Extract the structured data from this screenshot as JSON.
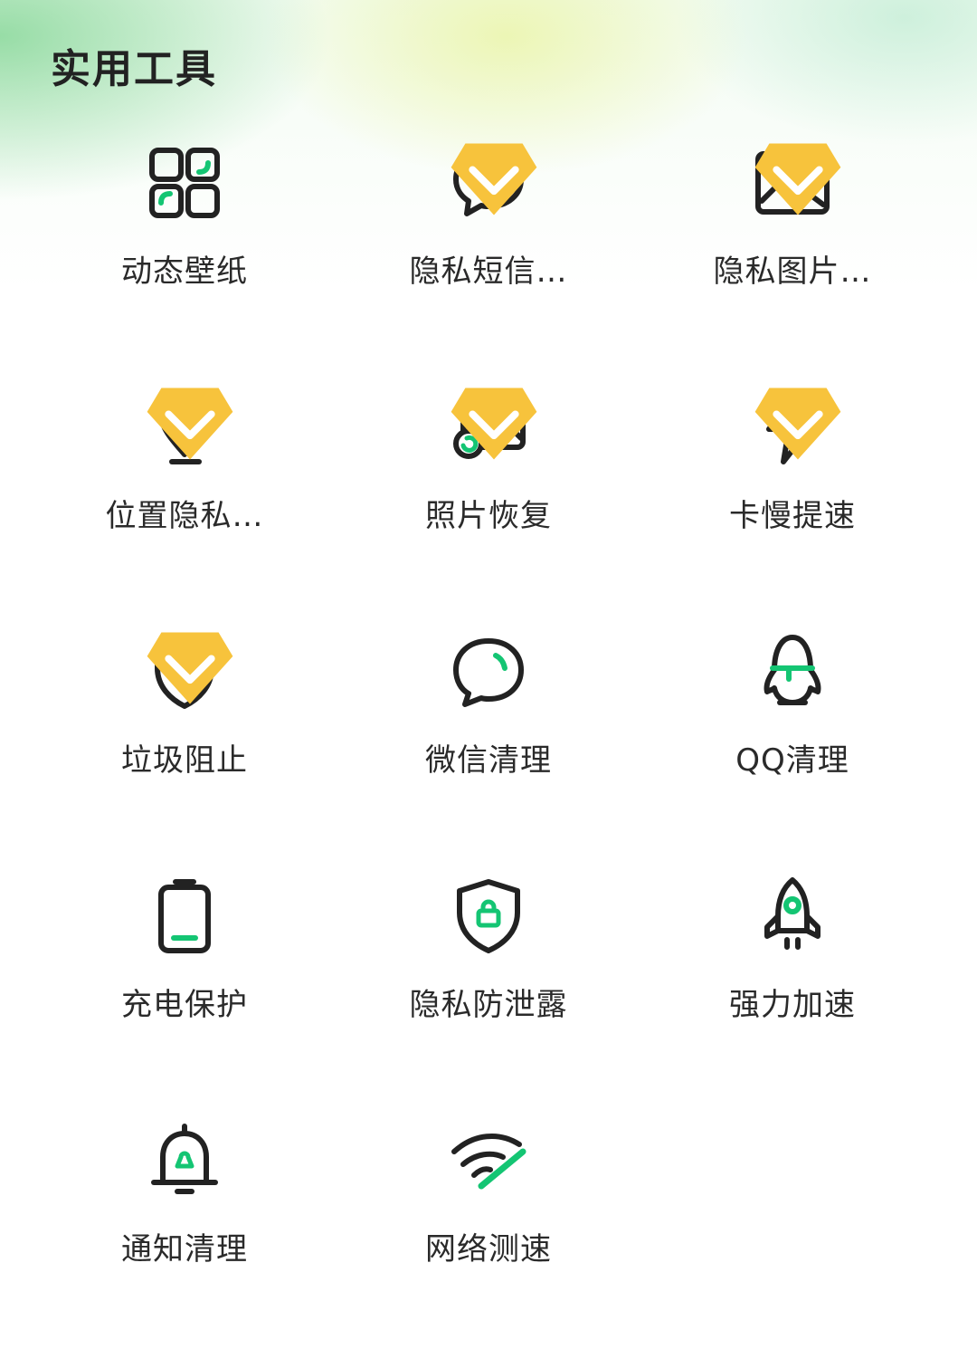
{
  "header": {
    "title": "实用工具"
  },
  "colors": {
    "accent": "#14c573",
    "stroke": "#222222",
    "vip_gold": "#f7c33c"
  },
  "tools": [
    {
      "label": "动态壁纸",
      "icon": "wallpaper-grid-icon",
      "vip": false
    },
    {
      "label": "隐私短信…",
      "icon": "chat-bubble-icon",
      "vip": true
    },
    {
      "label": "隐私图片…",
      "icon": "image-icon",
      "vip": true
    },
    {
      "label": "位置隐私…",
      "icon": "location-pin-icon",
      "vip": true
    },
    {
      "label": "照片恢复",
      "icon": "photo-restore-icon",
      "vip": true
    },
    {
      "label": "卡慢提速",
      "icon": "lightning-icon",
      "vip": true
    },
    {
      "label": "垃圾阻止",
      "icon": "shield-plus-icon",
      "vip": true
    },
    {
      "label": "微信清理",
      "icon": "wechat-bubble-icon",
      "vip": false
    },
    {
      "label": "QQ清理",
      "icon": "qq-penguin-icon",
      "vip": false
    },
    {
      "label": "充电保护",
      "icon": "battery-icon",
      "vip": false
    },
    {
      "label": "隐私防泄露",
      "icon": "shield-lock-icon",
      "vip": false
    },
    {
      "label": "强力加速",
      "icon": "rocket-icon",
      "vip": false
    },
    {
      "label": "通知清理",
      "icon": "bell-icon",
      "vip": false
    },
    {
      "label": "网络测速",
      "icon": "wifi-icon",
      "vip": false
    }
  ]
}
